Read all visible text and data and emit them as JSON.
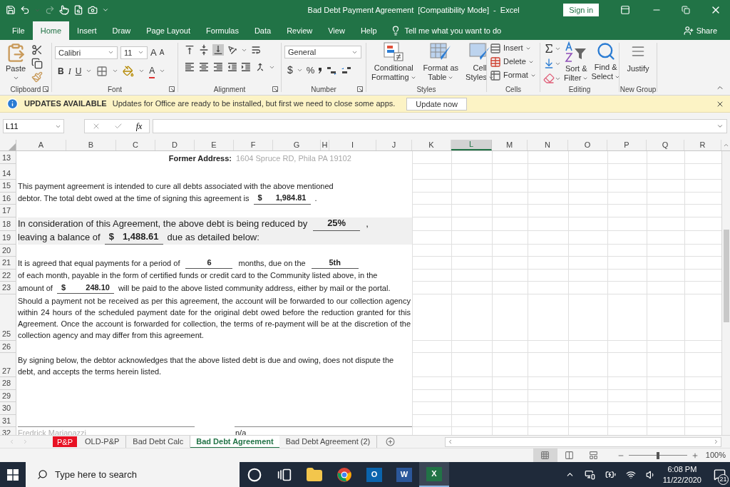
{
  "title_bar": {
    "title": "Bad Debt Payment Agreement  [Compatibility Mode]  -  Excel",
    "sign_in": "Sign in"
  },
  "menu_tabs": [
    {
      "label": "File",
      "selected": false
    },
    {
      "label": "Home",
      "selected": true
    },
    {
      "label": "Insert",
      "selected": false
    },
    {
      "label": "Draw",
      "selected": false
    },
    {
      "label": "Page Layout",
      "selected": false
    },
    {
      "label": "Formulas",
      "selected": false
    },
    {
      "label": "Data",
      "selected": false
    },
    {
      "label": "Review",
      "selected": false
    },
    {
      "label": "View",
      "selected": false
    },
    {
      "label": "Help",
      "selected": false
    }
  ],
  "tell_me": "Tell me what you want to do",
  "share": "Share",
  "ribbon": {
    "clipboard": {
      "label": "Clipboard",
      "paste": "Paste"
    },
    "font": {
      "label": "Font",
      "name": "Calibri",
      "size": "11",
      "grow": "A",
      "shrink": "A",
      "bold": "B",
      "italic": "I",
      "underline": "U",
      "font_color": "A"
    },
    "alignment": {
      "label": "Alignment"
    },
    "number": {
      "label": "Number",
      "format": "General",
      "currency": "$",
      "percent": "%"
    },
    "styles": {
      "label": "Styles",
      "buttons": [
        {
          "kind": "conditional",
          "lines": [
            "Conditional",
            "Formatting"
          ]
        },
        {
          "kind": "table",
          "lines": [
            "Format as",
            "Table"
          ]
        },
        {
          "kind": "cell",
          "lines": [
            "Cell",
            "Styles"
          ]
        }
      ]
    },
    "cells": {
      "label": "Cells",
      "buttons": [
        {
          "kind": "insert",
          "label": "Insert"
        },
        {
          "kind": "delete",
          "label": "Delete"
        },
        {
          "kind": "format",
          "label": "Format"
        }
      ]
    },
    "editing": {
      "label": "Editing",
      "buttons": [
        {
          "kind": "sort",
          "lines": [
            "Sort &",
            "Filter"
          ]
        },
        {
          "kind": "find",
          "lines": [
            "Find &",
            "Select"
          ]
        }
      ]
    },
    "new_group": {
      "label": "New Group",
      "button": "Justify"
    }
  },
  "update_bar": {
    "title": "UPDATES AVAILABLE",
    "message": "Updates for Office are ready to be installed, but first we need to close some apps.",
    "button": "Update now"
  },
  "formula_bar": {
    "name_box": "L11",
    "function_label": "fx"
  },
  "columns": [
    {
      "label": "A",
      "selected": false
    },
    {
      "label": "B",
      "selected": false
    },
    {
      "label": "C",
      "selected": false
    },
    {
      "label": "D",
      "selected": false
    },
    {
      "label": "E",
      "selected": false
    },
    {
      "label": "F",
      "selected": false
    },
    {
      "label": "G",
      "selected": false
    },
    {
      "label": "H",
      "selected": false
    },
    {
      "label": "I",
      "selected": false
    },
    {
      "label": "J",
      "selected": false
    },
    {
      "label": "K",
      "selected": false
    },
    {
      "label": "L",
      "selected": true
    },
    {
      "label": "M",
      "selected": false
    },
    {
      "label": "N",
      "selected": false
    },
    {
      "label": "O",
      "selected": false
    },
    {
      "label": "P",
      "selected": false
    },
    {
      "label": "Q",
      "selected": false
    },
    {
      "label": "R",
      "selected": false
    }
  ],
  "rows": [
    {
      "number": "13",
      "kind": "address",
      "label": "Former Address:",
      "value": "1604 Spruce RD, Phila PA  19102"
    },
    {
      "number": "14",
      "kind": "spacer"
    },
    {
      "number": "15",
      "kind": "line",
      "segments": [
        {
          "kind": "text",
          "text": "This payment agreement is intended to cure all debts associated with the above mentioned"
        }
      ]
    },
    {
      "number": "16",
      "kind": "line",
      "segments": [
        {
          "kind": "text",
          "text": "debtor.  The total debt owed at the time of signing this agreement is"
        },
        {
          "kind": "amount",
          "currency": "$",
          "value": "1,984.81"
        },
        {
          "kind": "text",
          "text": "."
        }
      ]
    },
    {
      "number": "17",
      "kind": "blank"
    },
    {
      "number": "18",
      "kind": "large",
      "segments": [
        {
          "kind": "text",
          "text": "In consideration of this Agreement, the above debt is being reduced by"
        },
        {
          "kind": "fill",
          "value": "25%"
        },
        {
          "kind": "text",
          "text": ","
        }
      ]
    },
    {
      "number": "19",
      "kind": "large",
      "segments": [
        {
          "kind": "text",
          "text": "leaving a balance of"
        },
        {
          "kind": "amount",
          "currency": "$",
          "value": "1,488.61"
        },
        {
          "kind": "text",
          "text": "due as detailed below:"
        }
      ]
    },
    {
      "number": "20",
      "kind": "blank"
    },
    {
      "number": "21",
      "kind": "line",
      "segments": [
        {
          "kind": "text",
          "text": "It is agreed that equal payments for a period of"
        },
        {
          "kind": "fill",
          "value": "6"
        },
        {
          "kind": "text",
          "text": "months, due on the"
        },
        {
          "kind": "fill",
          "value": "5th"
        }
      ]
    },
    {
      "number": "22",
      "kind": "line",
      "segments": [
        {
          "kind": "text",
          "text": "of each month, payable in the form of certified funds or credit card to the Community listed above, in the"
        }
      ]
    },
    {
      "number": "23",
      "kind": "line",
      "segments": [
        {
          "kind": "text",
          "text": "amount of"
        },
        {
          "kind": "amount",
          "currency": "$",
          "value": "248.10"
        },
        {
          "kind": "text",
          "text": "will be paid to the above listed community address, either by mail or the portal."
        }
      ]
    },
    {
      "number": "25",
      "kind": "paragraph",
      "text": "Should a payment not be received as per this agreement, the account will be forwarded to our collection agency within 24 hours of the scheduled payment date for the original debt owed before the reduction granted for this Agreement.  Once the account is forwarded for collection, the terms of re-payment will be at the discretion of the collection agency and may differ from this agreement."
    },
    {
      "number": "26",
      "kind": "blank"
    },
    {
      "number": "27",
      "kind": "wrapped",
      "text": "By signing below, the debtor acknowledges that the above listed debt is due and owing, does not dispute the debt, and accepts the terms herein listed."
    },
    {
      "number": "28",
      "kind": "blank"
    },
    {
      "number": "29",
      "kind": "blank"
    },
    {
      "number": "30",
      "kind": "blank"
    },
    {
      "number": "31",
      "kind": "signature_line"
    },
    {
      "number": "32",
      "kind": "signature",
      "name": "Fredrick Marianazzi",
      "value": "n/a"
    }
  ],
  "sheet_tabs": [
    {
      "label": "P&P",
      "selected": false,
      "color": "#e81123"
    },
    {
      "label": "OLD-P&P",
      "selected": false
    },
    {
      "label": "Bad Debt Calc",
      "selected": false
    },
    {
      "label": "Bad Debt Agreement",
      "selected": true
    },
    {
      "label": "Bad Debt Agreement (2)",
      "selected": false
    }
  ],
  "status_bar": {
    "views": [
      {
        "kind": "normal",
        "selected": true
      },
      {
        "kind": "page_layout",
        "selected": false
      },
      {
        "kind": "page_break",
        "selected": false
      }
    ],
    "zoom": {
      "level": 0.5,
      "reading": "100%"
    }
  },
  "taskbar": {
    "search_placeholder": "Type here to search",
    "apps": [
      {
        "kind": "cortana",
        "selected": false
      },
      {
        "kind": "task_view",
        "selected": false
      },
      {
        "kind": "explorer",
        "selected": false
      },
      {
        "kind": "browser",
        "selected": false
      },
      {
        "kind": "outlook",
        "letter": "O",
        "selected": false
      },
      {
        "kind": "word",
        "letter": "W",
        "selected": false
      },
      {
        "kind": "excel",
        "letter": "X",
        "selected": true
      }
    ],
    "time": "6:08 PM",
    "date": "11/22/2020",
    "notifications": "21"
  }
}
